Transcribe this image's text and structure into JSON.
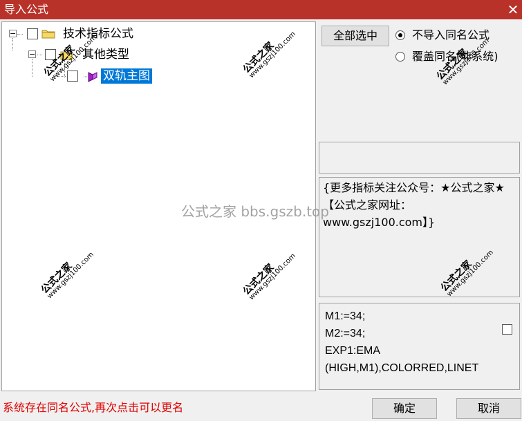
{
  "window": {
    "title": "导入公式",
    "close_glyph": "✕"
  },
  "tree": {
    "root_label": "技术指标公式",
    "child_label": "其他类型",
    "leaf_label": "双轨主图"
  },
  "actions": {
    "select_all_label": "全部选中",
    "ok_label": "确定",
    "cancel_label": "取消"
  },
  "options": {
    "skip_same_name_label": "不导入同名公式",
    "overwrite_same_name_label": "覆盖同名(非系统)"
  },
  "description": "{更多指标关注公众号：★公式之家★ 【公式之家网址：www.gszj100.com】}",
  "code_preview": [
    "M1:=34;",
    "M2:=34;",
    "EXP1:EMA",
    "(HIGH,M1),COLORRED,LINET"
  ],
  "status_message": "系统存在同名公式,再次点击可以更名",
  "watermark": {
    "center_text": "公式之家 bbs.gszb.top",
    "stamp_title": "公式之家",
    "stamp_url": "www.gszj100.com"
  },
  "colors": {
    "titlebar": "#b8322a",
    "status_text": "#e00000",
    "selection": "#0078d7"
  }
}
